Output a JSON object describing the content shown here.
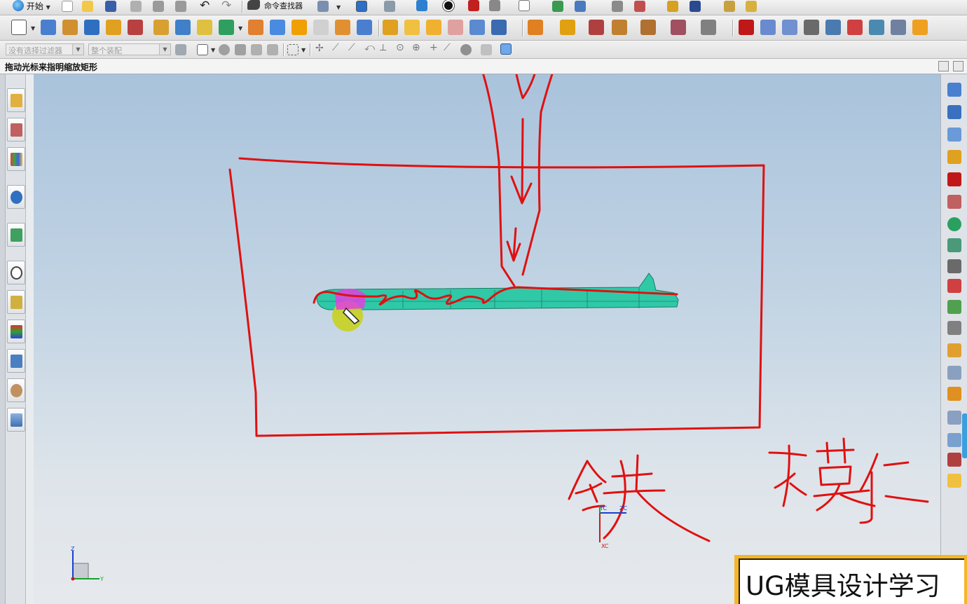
{
  "toolbar_top": {
    "start_label": "开始",
    "command_finder_label": "命令查找器"
  },
  "selection_bar": {
    "filter_placeholder": "没有选择过滤器",
    "assembly_placeholder": "整个装配"
  },
  "status": {
    "prompt": "拖动光标来指明缩放矩形"
  },
  "viewport": {
    "csys_labels": {
      "yc": "YC",
      "zc": "ZC",
      "xc": "XC"
    },
    "abs_csys_labels": {
      "z": "Z",
      "y": "Y"
    }
  },
  "annotations": {
    "handwriting": [
      "铁",
      "模仁"
    ]
  },
  "watermark": {
    "text": "UG模具设计学习"
  },
  "colors": {
    "annotation_red": "#e01010",
    "part_teal": "#2fc9a8",
    "highlight_magenta": "#e040e0",
    "watermark_border": "#f6b624"
  },
  "icons": {
    "left_panel": [
      "assembly-navigator-icon",
      "part-navigator-icon",
      "reuse-library-icon",
      "history-icon",
      "web-browser-icon",
      "clock-history-icon",
      "system-materials-icon",
      "color-palette-icon",
      "process-studio-icon",
      "roles-icon",
      "system-scenes-icon"
    ],
    "right_panel": [
      "extrude-icon",
      "revolve-icon",
      "sweep-icon",
      "block-icon",
      "cylinder-icon",
      "boolean-icon",
      "union-icon",
      "subtract-icon",
      "intersect-icon",
      "datum-icon",
      "plane-icon",
      "trim-icon",
      "offset-face-icon",
      "shell-icon",
      "pattern-icon",
      "mirror-icon",
      "blend-icon",
      "chamfer-icon"
    ]
  }
}
